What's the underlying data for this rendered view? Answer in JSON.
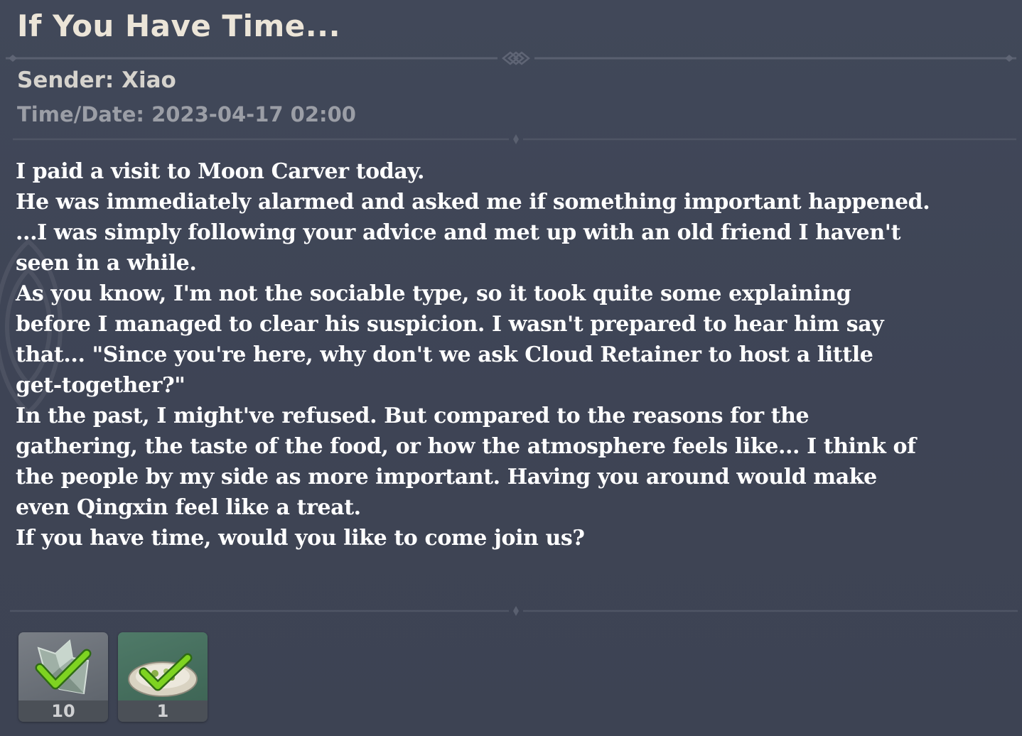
{
  "mail": {
    "title": "If You Have Time...",
    "sender": "Sender: Xiao",
    "time_date": "Time/Date: 2023-04-17 02:00",
    "body": [
      "I paid a visit to Moon Carver today.",
      "He was immediately alarmed and asked me if something important happened.",
      "...I was simply following your advice and met up with an old friend I haven't",
      "seen in a while.",
      "As you know, I'm not the sociable type, so it took quite some explaining",
      "before I managed to clear his suspicion. I wasn't prepared to hear him say",
      "that... \"Since you're here, why don't we ask Cloud Retainer to host a little",
      "get-together?\"",
      "In the past, I might've refused. But compared to the reasons for the",
      "gathering, the taste of the food, or how the atmosphere feels like... I think of",
      "the people by my side as more important. Having you around would make",
      "even Qingxin feel like a treat.",
      "If you have time, would you like to come join us?"
    ]
  },
  "attachments": [
    {
      "icon": "crystal-item-icon",
      "count": "10",
      "claimed": true,
      "rarity_color": "#6a7078"
    },
    {
      "icon": "dish-item-icon",
      "count": "1",
      "claimed": true,
      "rarity_color": "#4a7a66"
    }
  ],
  "colors": {
    "background": "#3f4556",
    "title": "#ece5d8",
    "checkmark": "#7ed321"
  }
}
